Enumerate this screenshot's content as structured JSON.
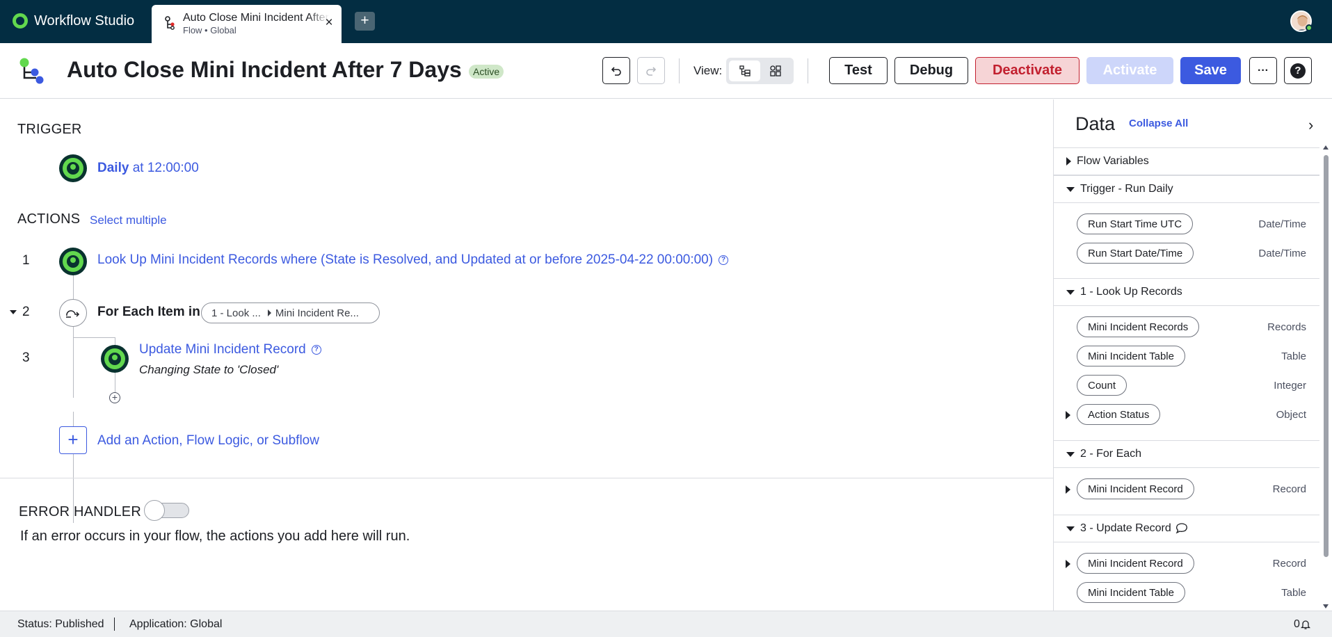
{
  "app": {
    "name": "Workflow Studio"
  },
  "tab": {
    "title": "Auto Close Mini Incident After 7 Days",
    "subtitle": "Flow • Global",
    "close_glyph": "×"
  },
  "newtab_glyph": "+",
  "flow": {
    "title": "Auto Close Mini Incident After 7 Days",
    "status_badge": "Active",
    "view_label": "View:"
  },
  "toolbar": {
    "test": "Test",
    "debug": "Debug",
    "deactivate": "Deactivate",
    "activate": "Activate",
    "save": "Save",
    "more_glyph": "···",
    "help_glyph": "?"
  },
  "trigger": {
    "section": "TRIGGER",
    "name": "Daily",
    "detail": " at 12:00:00"
  },
  "actions": {
    "section": "ACTIONS",
    "select_multiple": "Select multiple",
    "steps": [
      {
        "num": "1",
        "label": "Look Up Mini Incident Records where (State is Resolved, and Updated at or before 2025-04-22 00:00:00)"
      },
      {
        "num": "2",
        "label": "For Each Item in",
        "pill_a": "1 - Look ...",
        "pill_b": "Mini Incident Re..."
      },
      {
        "num": "3",
        "label": "Update Mini Incident Record",
        "sub": "Changing State to 'Closed'"
      }
    ],
    "add_label": "Add an Action, Flow Logic, or Subflow"
  },
  "error_handler": {
    "section": "ERROR HANDLER",
    "description": "If an error occurs in your flow, the actions you add here will run.",
    "enabled": false
  },
  "data_panel": {
    "title": "Data",
    "collapse_all": "Collapse All",
    "chevron": "›",
    "groups": [
      {
        "label": "Flow Variables",
        "expanded": false
      },
      {
        "label": "Trigger - Run Daily",
        "expanded": true,
        "items": [
          {
            "name": "Run Start Time UTC",
            "type": "Date/Time"
          },
          {
            "name": "Run Start Date/Time",
            "type": "Date/Time"
          }
        ]
      },
      {
        "label": "1 - Look Up Records",
        "expanded": true,
        "items": [
          {
            "name": "Mini Incident Records",
            "type": "Records"
          },
          {
            "name": "Mini Incident Table",
            "type": "Table"
          },
          {
            "name": "Count",
            "type": "Integer"
          },
          {
            "name": "Action Status",
            "type": "Object"
          }
        ]
      },
      {
        "label": "2 - For Each",
        "expanded": true,
        "items": [
          {
            "name": "Mini Incident Record",
            "type": "Record"
          }
        ]
      },
      {
        "label": "3 - Update Record",
        "expanded": true,
        "items": [
          {
            "name": "Mini Incident Record",
            "type": "Record"
          },
          {
            "name": "Mini Incident Table",
            "type": "Table"
          }
        ]
      }
    ]
  },
  "statusbar": {
    "status": "Status: Published",
    "application": "Application: Global",
    "notifications": "0"
  },
  "colors": {
    "accent": "#3c5ae0",
    "nav_bg": "#032d42",
    "node_green": "#62d84e",
    "danger": "#c2202f"
  }
}
